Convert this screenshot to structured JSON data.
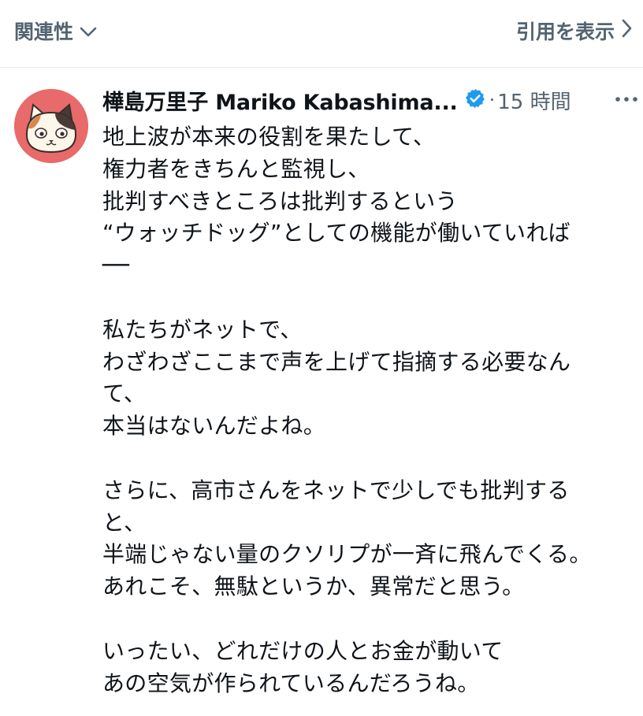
{
  "topbar": {
    "sort_label": "関連性",
    "quote_link_label": "引用を表示"
  },
  "post": {
    "author_name": "樺島万里子 Mariko Kabashima...",
    "separator": "·",
    "time_ago": "15 時間",
    "lines": [
      "地上波が本来の役割を果たして、",
      "権力者をきちんと監視し、",
      "批判すべきところは批判するという",
      "“ウォッチドッグ”としての機能が働いていれば",
      "──",
      "",
      "私たちがネットで、",
      "わざわざここまで声を上げて指摘する必要なん",
      "て、",
      "本当はないんだよね。",
      "",
      "さらに、高市さんをネットで少しでも批判する",
      "と、",
      "半端じゃない量のクソリプが一斉に飛んでくる。",
      "あれこそ、無駄というか、異常だと思う。",
      "",
      "いったい、どれだけの人とお金が動いて",
      "あの空気が作られているんだろうね。"
    ]
  },
  "colors": {
    "secondary_text": "#536471",
    "verified_blue": "#1d9bf0",
    "avatar_bg": "#e86a6a"
  },
  "icons": {
    "sort_dropdown": "chevron-down-icon",
    "quote_link": "chevron-right-icon",
    "verified": "verified-badge-icon",
    "more": "more-options-icon"
  }
}
